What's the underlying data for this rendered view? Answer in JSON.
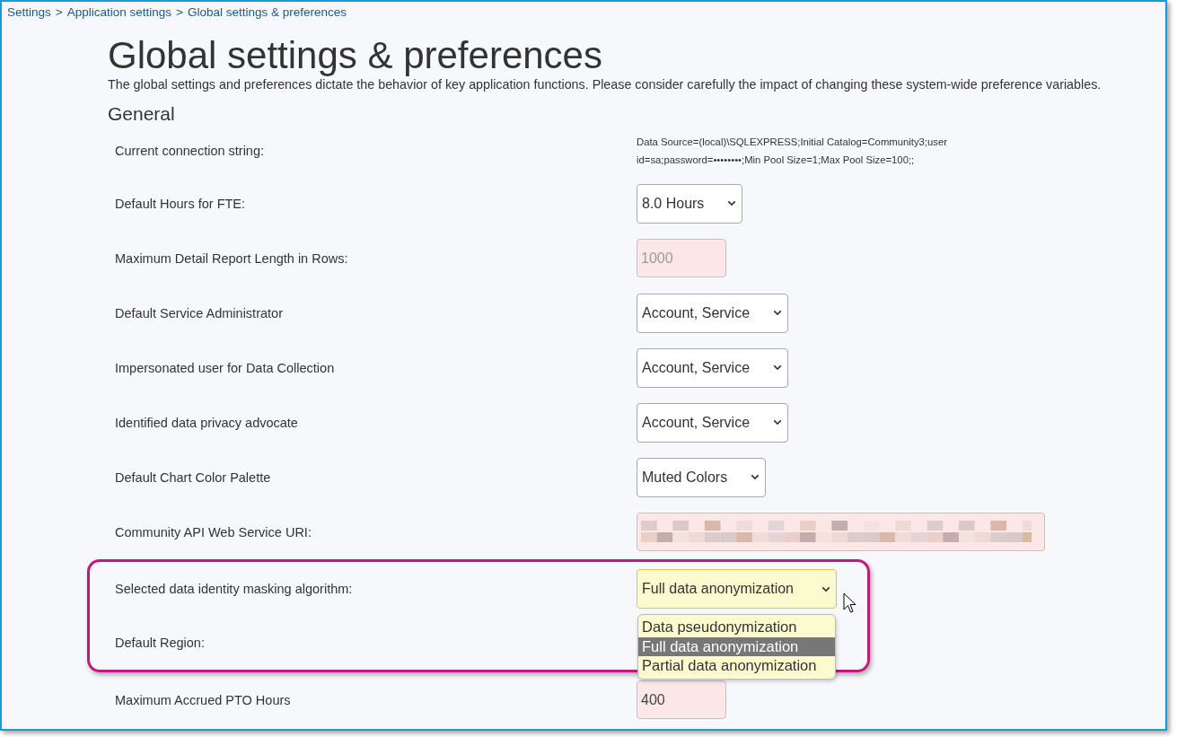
{
  "breadcrumb": {
    "separator": ">",
    "items": [
      {
        "label": "Settings"
      },
      {
        "label": "Application settings"
      },
      {
        "label": "Global settings & preferences"
      }
    ]
  },
  "title": "Global settings & preferences",
  "description": "The global settings and preferences dictate the behavior of key application functions. Please consider carefully the impact of changing these system-wide preference variables.",
  "section": "General",
  "rows": [
    {
      "label": "Current connection string:",
      "kind": "text",
      "value": "Data Source=(local)\\SQLEXPRESS;Initial Catalog=Community3;user id=sa;password=••••••••;Min Pool Size=1;Max Pool Size=100;;",
      "highlighted": false
    },
    {
      "label": "Default Hours for FTE:",
      "kind": "select",
      "value": "8.0 Hours",
      "highlighted": false
    },
    {
      "label": "Maximum Detail Report Length in Rows:",
      "kind": "input",
      "value": "1000",
      "disabled": true,
      "highlighted": false
    },
    {
      "label": "Default Service Administrator",
      "kind": "select",
      "value": "Account, Service",
      "highlighted": false
    },
    {
      "label": "Impersonated user for Data Collection",
      "kind": "select",
      "value": "Account, Service",
      "highlighted": false
    },
    {
      "label": "Identified data privacy advocate",
      "kind": "select",
      "value": "Account, Service",
      "highlighted": false
    },
    {
      "label": "Default Chart Color Palette",
      "kind": "select",
      "value": "Muted Colors",
      "highlighted": false
    },
    {
      "label": "Community API Web Service URI:",
      "kind": "redacted",
      "highlighted": false
    },
    {
      "label": "Selected data identity masking algorithm:",
      "kind": "open-select",
      "value": "Full data anonymization",
      "highlighted": true,
      "options": [
        {
          "label": "Data pseudonymization",
          "selected": false
        },
        {
          "label": "Full data anonymization",
          "selected": true
        },
        {
          "label": "Partial data anonymization",
          "selected": false
        }
      ]
    },
    {
      "label": "Default Region:",
      "kind": "hidden",
      "highlighted": true
    },
    {
      "label": "Maximum Accrued PTO Hours",
      "kind": "input",
      "value": "400",
      "disabled": false,
      "highlighted": false
    }
  ]
}
